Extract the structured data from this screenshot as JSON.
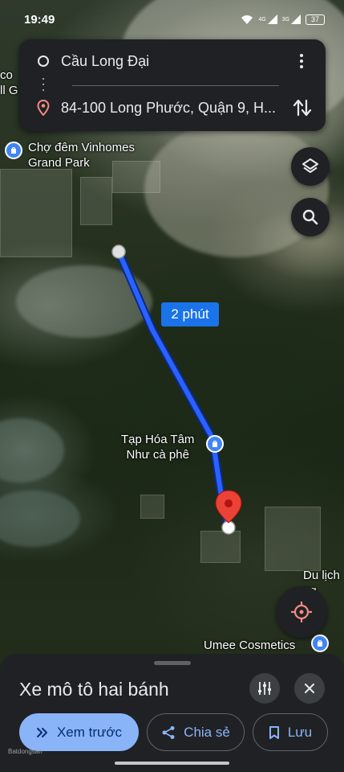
{
  "status_bar": {
    "time": "19:49",
    "net_a": "4G",
    "net_b": "3G",
    "battery": "37"
  },
  "route_card": {
    "origin": "Cầu Long Đại",
    "destination": "84-100 Long Phước, Quận 9, H..."
  },
  "map": {
    "places": {
      "cho_dem": "Chợ đêm Vinhomes\nGrand Park",
      "tap_hoa": "Tạp Hóa Tâm\nNhư cà phê",
      "umee": "Umee Cosmetics",
      "du_lich": "Du lịch\nng\ndón",
      "edge_left": "co\nll G",
      "edge_right": "Đ"
    },
    "duration_label": "2 phút",
    "accent": "#1a73e8",
    "route_color": "#1f5cf5",
    "pin_color": "#ea4335"
  },
  "bottom_sheet": {
    "mode_title": "Xe mô tô hai bánh",
    "preview_label": "Xem trước",
    "share_label": "Chia sẻ",
    "save_label": "Lưu"
  },
  "watermark": "Batdongsan"
}
